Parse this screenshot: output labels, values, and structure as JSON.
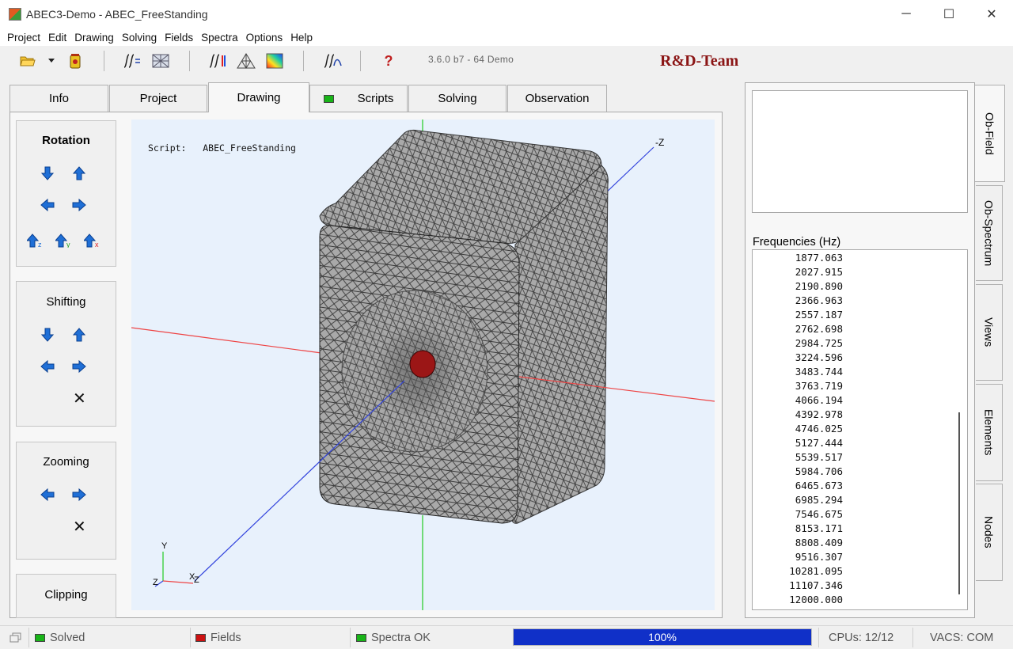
{
  "window": {
    "title": "ABEC3-Demo - ABEC_FreeStanding",
    "controls": [
      "─",
      "☐",
      "✕"
    ]
  },
  "menu": [
    "Project",
    "Edit",
    "Drawing",
    "Solving",
    "Fields",
    "Spectra",
    "Options",
    "Help"
  ],
  "toolbar": {
    "version": "3.6.0 b7 - 64 Demo",
    "brand": "R&D-Team",
    "help_glyph": "?"
  },
  "tabs": [
    {
      "label": "Info",
      "active": false
    },
    {
      "label": "Project",
      "active": false
    },
    {
      "label": "Drawing",
      "active": true
    },
    {
      "label": "Scripts",
      "active": false,
      "led": "#18b418"
    },
    {
      "label": "Solving",
      "active": false
    },
    {
      "label": "Observation",
      "active": false
    }
  ],
  "controls": {
    "rotation": "Rotation",
    "shifting": "Shifting",
    "zooming": "Zooming",
    "clipping": "Clipping",
    "axis_subs": [
      "z",
      "y",
      "x"
    ],
    "reset_glyph": "✕"
  },
  "viewport": {
    "script_prefix": "Script:",
    "script_name": "ABEC_FreeStanding",
    "axis_label_neg_z": "-Z",
    "triad": {
      "y": "Y",
      "z": "Z",
      "x": "X",
      "z2": "Z"
    },
    "colors": {
      "x_axis": "#ee4444",
      "y_axis": "#22cc22",
      "z_axis": "#3344dd",
      "mesh_dark": "#3a3a3a",
      "mesh_light": "#a9a9a9",
      "driver": "#9b1616"
    }
  },
  "right_panel": {
    "freq_label": "Frequencies  (Hz)",
    "frequencies": [
      "1877.063",
      "2027.915",
      "2190.890",
      "2366.963",
      "2557.187",
      "2762.698",
      "2984.725",
      "3224.596",
      "3483.744",
      "3763.719",
      "4066.194",
      "4392.978",
      "4746.025",
      "5127.444",
      "5539.517",
      "5984.706",
      "6465.673",
      "6985.294",
      "7546.675",
      "8153.171",
      "8808.409",
      "9516.307",
      "10281.095",
      "11107.346",
      "12000.000"
    ],
    "vtabs": [
      "Ob-Field",
      "Ob-Spectrum",
      "Views",
      "Elements",
      "Nodes"
    ]
  },
  "status": {
    "solved": "Solved",
    "solved_led": "#18b418",
    "fields": "Fields",
    "fields_led": "#cc1111",
    "spectra": "Spectra OK",
    "spectra_led": "#18b418",
    "progress_value": 1.0,
    "progress_text": "100%",
    "cpus": "CPUs: 12/12",
    "vacs": "VACS: COM"
  }
}
